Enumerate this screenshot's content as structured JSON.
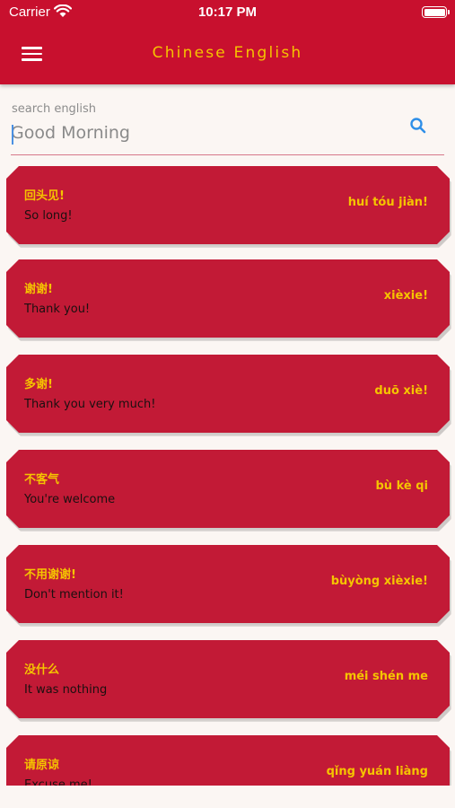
{
  "status_bar": {
    "carrier": "Carrier",
    "time": "10:17 PM"
  },
  "header": {
    "title": "Chinese English",
    "menu_icon": "hamburger-menu-icon"
  },
  "search": {
    "label": "search english",
    "placeholder": "Good Morning",
    "icon": "search-icon"
  },
  "phrases": [
    {
      "chinese": "回头见!",
      "english": "So long!",
      "pinyin": "huí tóu jiàn!"
    },
    {
      "chinese": "谢谢!",
      "english": "Thank you!",
      "pinyin": "xièxie!"
    },
    {
      "chinese": "多谢!",
      "english": "Thank you very much!",
      "pinyin": "duō xiè!"
    },
    {
      "chinese": "不客气",
      "english": "You're welcome",
      "pinyin": "bù kè qi"
    },
    {
      "chinese": "不用谢谢!",
      "english": "Don't mention it!",
      "pinyin": "bùyòng xièxie!"
    },
    {
      "chinese": "没什么",
      "english": "It was nothing",
      "pinyin": "méi shén me"
    },
    {
      "chinese": "请原谅",
      "english": "Excuse me!",
      "pinyin": "qǐng yuán liàng"
    }
  ],
  "colors": {
    "header": "#c8102e",
    "card": "#c21a36",
    "accent": "#f5c400",
    "background": "#fbf6f3"
  }
}
